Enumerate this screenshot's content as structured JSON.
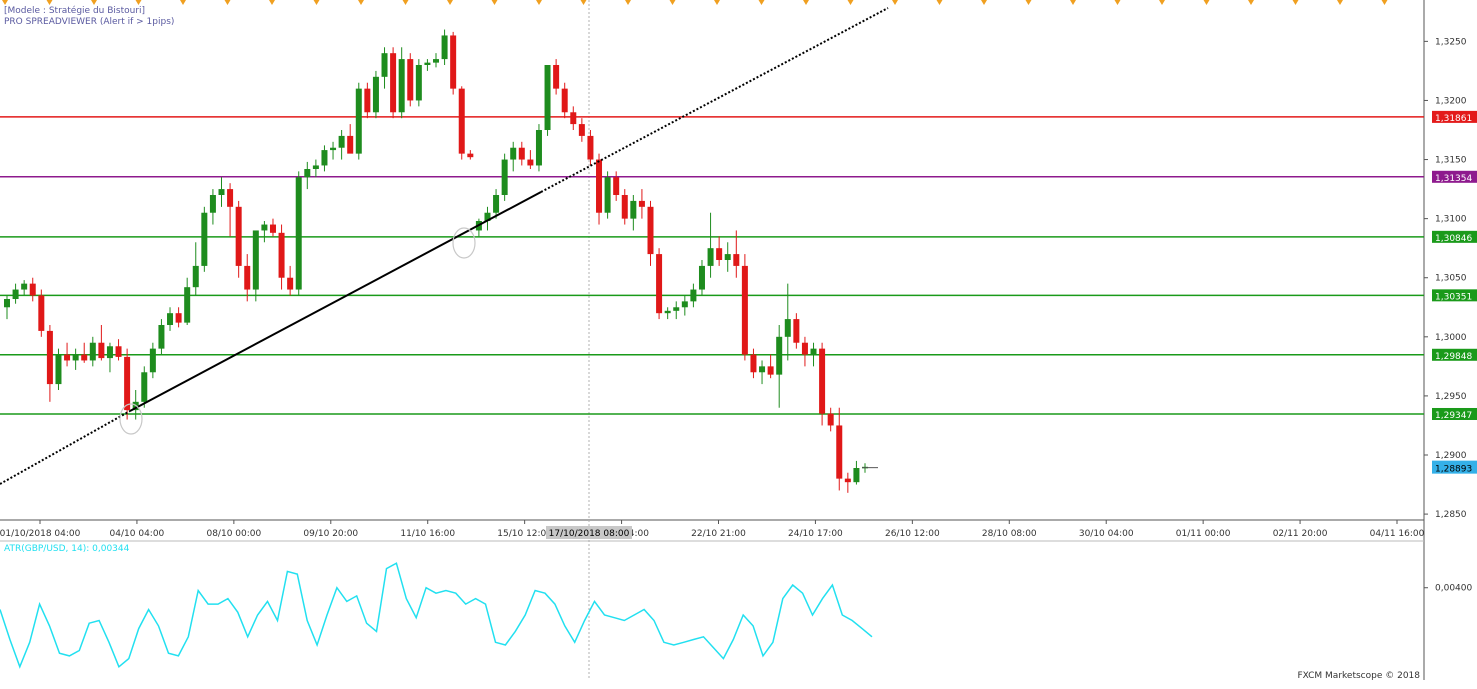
{
  "header": {
    "line1": "[Modele : Stratégie du Bistouri]",
    "line2": "PRO SPREADVIEWER (Alert if > 1pips)"
  },
  "colors": {
    "up_candle": "#1e8c1e",
    "down_candle": "#e01818",
    "resistance_red": "#e31a1a",
    "purple_level": "#8e1a8e",
    "green_level": "#1a9a1a",
    "atr_line": "#22e0f0",
    "current_price_bg": "#34b0e8",
    "trendline": "#000000",
    "crosshair": "#b0b0b0"
  },
  "chart_data": [
    {
      "type": "candlestick",
      "symbol": "GBP/USD",
      "ylim": [
        1.2845,
        1.3285
      ],
      "y_ticks": [
        "1,3250",
        "1,3200",
        "1,3150",
        "1,3100",
        "1,3050",
        "1,3000",
        "1,2950",
        "1,2900",
        "1,2850"
      ],
      "x_ticks": [
        "01/10/2018 04:00",
        "04/10 04:00",
        "08/10 00:00",
        "09/10 20:00",
        "11/10 16:00",
        "15/10 12:00",
        "19/10 04:00",
        "22/10 21:00",
        "24/10 17:00",
        "26/10 12:00",
        "28/10 08:00",
        "30/10 04:00",
        "01/11 00:00",
        "02/11 20:00",
        "04/11 16:00"
      ],
      "crosshair_label": "17/10/2018 08:00",
      "horizontal_levels": [
        {
          "label": "1,31861",
          "value": 1.31861,
          "color": "#e31a1a",
          "label_bg": "#e31a1a"
        },
        {
          "label": "1,31354",
          "value": 1.31354,
          "color": "#8e1a8e",
          "label_bg": "#8e1a8e"
        },
        {
          "label": "1,30846",
          "value": 1.30846,
          "color": "#1a9a1a",
          "label_bg": "#1a9a1a"
        },
        {
          "label": "1,30351",
          "value": 1.30351,
          "color": "#1a9a1a",
          "label_bg": "#1a9a1a"
        },
        {
          "label": "1,29848",
          "value": 1.29848,
          "color": "#1a9a1a",
          "label_bg": "#1a9a1a"
        },
        {
          "label": "1,29347",
          "value": 1.29347,
          "color": "#1a9a1a",
          "label_bg": "#1a9a1a"
        }
      ],
      "current_price": {
        "label": "1,28893",
        "value": 1.28893
      },
      "candles": [
        [
          1.3025,
          1.3035,
          1.3015,
          1.3032
        ],
        [
          1.3032,
          1.3045,
          1.3028,
          1.304
        ],
        [
          1.304,
          1.3048,
          1.3035,
          1.3045
        ],
        [
          1.3045,
          1.305,
          1.303,
          1.3035
        ],
        [
          1.3035,
          1.304,
          1.3,
          1.3005
        ],
        [
          1.3005,
          1.301,
          1.2945,
          1.296
        ],
        [
          1.296,
          1.299,
          1.2955,
          1.2985
        ],
        [
          1.2985,
          1.2995,
          1.2975,
          1.298
        ],
        [
          1.298,
          1.299,
          1.2972,
          1.2985
        ],
        [
          1.2985,
          1.2995,
          1.2978,
          1.298
        ],
        [
          1.298,
          1.3,
          1.2975,
          1.2995
        ],
        [
          1.2995,
          1.301,
          1.298,
          1.2982
        ],
        [
          1.2982,
          1.2995,
          1.297,
          1.2992
        ],
        [
          1.2992,
          1.2998,
          1.298,
          1.2983
        ],
        [
          1.2983,
          1.299,
          1.293,
          1.2938
        ],
        [
          1.2938,
          1.2955,
          1.293,
          1.2945
        ],
        [
          1.2945,
          1.2975,
          1.294,
          1.297
        ],
        [
          1.297,
          1.2995,
          1.2965,
          1.299
        ],
        [
          1.299,
          1.3015,
          1.2985,
          1.301
        ],
        [
          1.301,
          1.3025,
          1.3005,
          1.302
        ],
        [
          1.302,
          1.3025,
          1.3008,
          1.3012
        ],
        [
          1.3012,
          1.305,
          1.301,
          1.3042
        ],
        [
          1.3042,
          1.308,
          1.3035,
          1.306
        ],
        [
          1.306,
          1.311,
          1.3055,
          1.3105
        ],
        [
          1.3105,
          1.3125,
          1.3095,
          1.312
        ],
        [
          1.312,
          1.3135,
          1.311,
          1.3125
        ],
        [
          1.3125,
          1.313,
          1.3085,
          1.311
        ],
        [
          1.311,
          1.3115,
          1.305,
          1.306
        ],
        [
          1.306,
          1.307,
          1.303,
          1.304
        ],
        [
          1.304,
          1.307,
          1.303,
          1.309
        ],
        [
          1.309,
          1.3098,
          1.308,
          1.3095
        ],
        [
          1.3095,
          1.31,
          1.3085,
          1.3088
        ],
        [
          1.3088,
          1.3095,
          1.304,
          1.305
        ],
        [
          1.305,
          1.306,
          1.3035,
          1.304
        ],
        [
          1.304,
          1.314,
          1.3035,
          1.3135
        ],
        [
          1.3135,
          1.3148,
          1.3125,
          1.3142
        ],
        [
          1.3142,
          1.315,
          1.3135,
          1.3145
        ],
        [
          1.3145,
          1.3162,
          1.314,
          1.3158
        ],
        [
          1.3158,
          1.3165,
          1.315,
          1.316
        ],
        [
          1.316,
          1.3175,
          1.315,
          1.317
        ],
        [
          1.317,
          1.318,
          1.316,
          1.3155
        ],
        [
          1.3155,
          1.3215,
          1.315,
          1.321
        ],
        [
          1.321,
          1.3215,
          1.3185,
          1.319
        ],
        [
          1.319,
          1.3225,
          1.3185,
          1.322
        ],
        [
          1.322,
          1.3245,
          1.321,
          1.324
        ],
        [
          1.324,
          1.3245,
          1.3185,
          1.319
        ],
        [
          1.319,
          1.3245,
          1.3185,
          1.3235
        ],
        [
          1.3235,
          1.324,
          1.3195,
          1.32
        ],
        [
          1.32,
          1.3235,
          1.3195,
          1.323
        ],
        [
          1.323,
          1.3235,
          1.3225,
          1.3232
        ],
        [
          1.3232,
          1.324,
          1.3228,
          1.3235
        ],
        [
          1.3235,
          1.326,
          1.323,
          1.3255
        ],
        [
          1.3255,
          1.3258,
          1.3205,
          1.321
        ],
        [
          1.321,
          1.3212,
          1.315,
          1.3155
        ],
        [
          1.3155,
          1.3158,
          1.315,
          1.3152
        ],
        [
          1.309,
          1.31,
          1.3085,
          1.3098
        ],
        [
          1.3098,
          1.311,
          1.309,
          1.3105
        ],
        [
          1.3105,
          1.3125,
          1.31,
          1.312
        ],
        [
          1.312,
          1.3155,
          1.3115,
          1.315
        ],
        [
          1.315,
          1.3165,
          1.314,
          1.316
        ],
        [
          1.316,
          1.3165,
          1.3145,
          1.315
        ],
        [
          1.315,
          1.3158,
          1.3142,
          1.3145
        ],
        [
          1.3145,
          1.318,
          1.314,
          1.3175
        ],
        [
          1.3175,
          1.322,
          1.317,
          1.323
        ],
        [
          1.323,
          1.3235,
          1.3205,
          1.321
        ],
        [
          1.321,
          1.3215,
          1.3185,
          1.319
        ],
        [
          1.319,
          1.3195,
          1.3175,
          1.318
        ],
        [
          1.318,
          1.3185,
          1.3165,
          1.317
        ],
        [
          1.317,
          1.3175,
          1.3145,
          1.315
        ],
        [
          1.315,
          1.3155,
          1.3095,
          1.3105
        ],
        [
          1.3105,
          1.314,
          1.31,
          1.3135
        ],
        [
          1.3135,
          1.314,
          1.3115,
          1.312
        ],
        [
          1.312,
          1.3125,
          1.3095,
          1.31
        ],
        [
          1.31,
          1.312,
          1.309,
          1.3115
        ],
        [
          1.3115,
          1.3125,
          1.31,
          1.311
        ],
        [
          1.311,
          1.3115,
          1.306,
          1.307
        ],
        [
          1.307,
          1.3075,
          1.3015,
          1.302
        ],
        [
          1.302,
          1.3025,
          1.3015,
          1.3022
        ],
        [
          1.3022,
          1.303,
          1.3015,
          1.3025
        ],
        [
          1.3025,
          1.3035,
          1.3018,
          1.303
        ],
        [
          1.303,
          1.3045,
          1.3025,
          1.304
        ],
        [
          1.304,
          1.3065,
          1.3035,
          1.306
        ],
        [
          1.306,
          1.3105,
          1.305,
          1.3075
        ],
        [
          1.3075,
          1.3085,
          1.306,
          1.3065
        ],
        [
          1.3065,
          1.308,
          1.3055,
          1.307
        ],
        [
          1.307,
          1.309,
          1.305,
          1.306
        ],
        [
          1.306,
          1.307,
          1.298,
          1.2985
        ],
        [
          1.2985,
          1.299,
          1.2965,
          1.297
        ],
        [
          1.297,
          1.298,
          1.296,
          1.2975
        ],
        [
          1.2975,
          1.2985,
          1.2965,
          1.2968
        ],
        [
          1.2968,
          1.301,
          1.294,
          1.3
        ],
        [
          1.3,
          1.3045,
          1.298,
          1.3015
        ],
        [
          1.3015,
          1.302,
          1.299,
          1.2995
        ],
        [
          1.2995,
          1.3,
          1.2975,
          1.2985
        ],
        [
          1.2985,
          1.2995,
          1.2975,
          1.299
        ],
        [
          1.299,
          1.2995,
          1.2925,
          1.2935
        ],
        [
          1.2935,
          1.294,
          1.292,
          1.2925
        ],
        [
          1.2925,
          1.294,
          1.287,
          1.288
        ],
        [
          1.288,
          1.2885,
          1.2868,
          1.2877
        ],
        [
          1.2877,
          1.2895,
          1.2875,
          1.2889
        ],
        [
          1.2889,
          1.2893,
          1.2885,
          1.289
        ]
      ],
      "trendline": {
        "style": "solid then dotted extension"
      },
      "watermark": ""
    },
    {
      "type": "line",
      "label": "ATR(GBP/USD, 14): 0,00344",
      "y_ticks": [
        "0,00400"
      ],
      "series": [
        {
          "name": "ATR(GBP/USD, 14)",
          "values": [
            0.0036,
            0.00305,
            0.00255,
            0.003,
            0.0037,
            0.0033,
            0.0028,
            0.00275,
            0.00285,
            0.00335,
            0.0034,
            0.003,
            0.00255,
            0.0027,
            0.00325,
            0.0036,
            0.0033,
            0.0028,
            0.00275,
            0.0031,
            0.00395,
            0.0037,
            0.0037,
            0.0038,
            0.00355,
            0.0031,
            0.0035,
            0.00375,
            0.0034,
            0.0043,
            0.00425,
            0.0034,
            0.00295,
            0.0035,
            0.004,
            0.00375,
            0.00385,
            0.00335,
            0.0032,
            0.00435,
            0.00445,
            0.0038,
            0.00345,
            0.004,
            0.0039,
            0.00395,
            0.0039,
            0.0037,
            0.0038,
            0.0037,
            0.003,
            0.00295,
            0.0032,
            0.0035,
            0.00395,
            0.0039,
            0.0037,
            0.0033,
            0.003,
            0.0034,
            0.00375,
            0.0035,
            0.00345,
            0.0034,
            0.0035,
            0.0036,
            0.0034,
            0.003,
            0.00295,
            0.003,
            0.00305,
            0.0031,
            0.0029,
            0.0027,
            0.00305,
            0.0035,
            0.0033,
            0.00275,
            0.003,
            0.0038,
            0.00405,
            0.0039,
            0.0035,
            0.0038,
            0.00405,
            0.0035,
            0.0034,
            0.00325,
            0.0031
          ]
        }
      ]
    }
  ],
  "footer": {
    "copyright": "FXCM Marketscope © 2018"
  }
}
